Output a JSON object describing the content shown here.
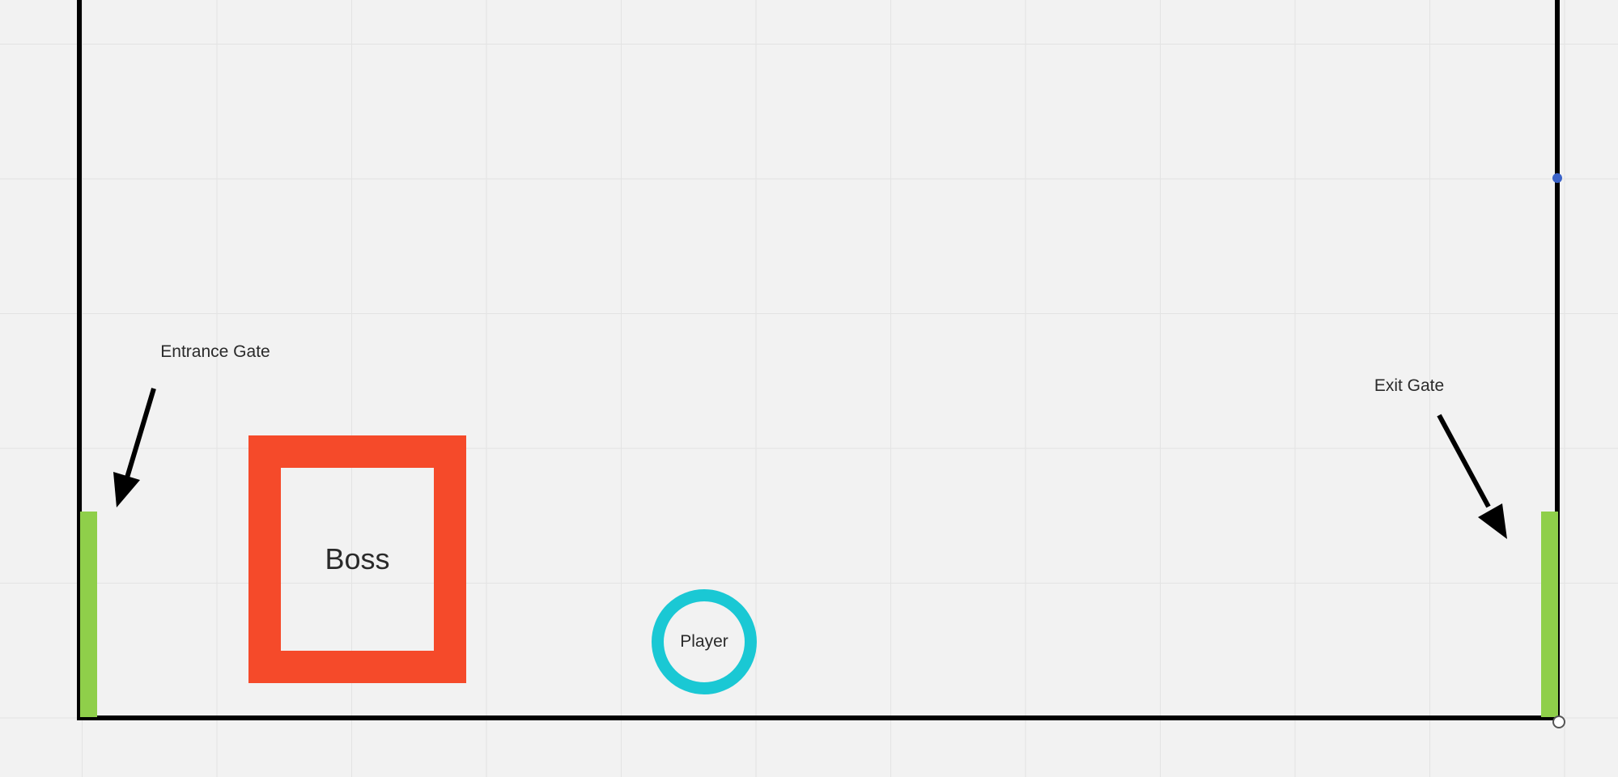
{
  "diagram": {
    "entrance_gate": {
      "label": "Entrance Gate",
      "color": "#8fcf4a"
    },
    "exit_gate": {
      "label": "Exit Gate",
      "color": "#8fcf4a"
    },
    "boss": {
      "label": "Boss",
      "color": "#f54a2a"
    },
    "player": {
      "label": "Player",
      "color": "#1ac8d4"
    },
    "wall_color": "#000000",
    "grid_color": "#e3e3e3"
  }
}
